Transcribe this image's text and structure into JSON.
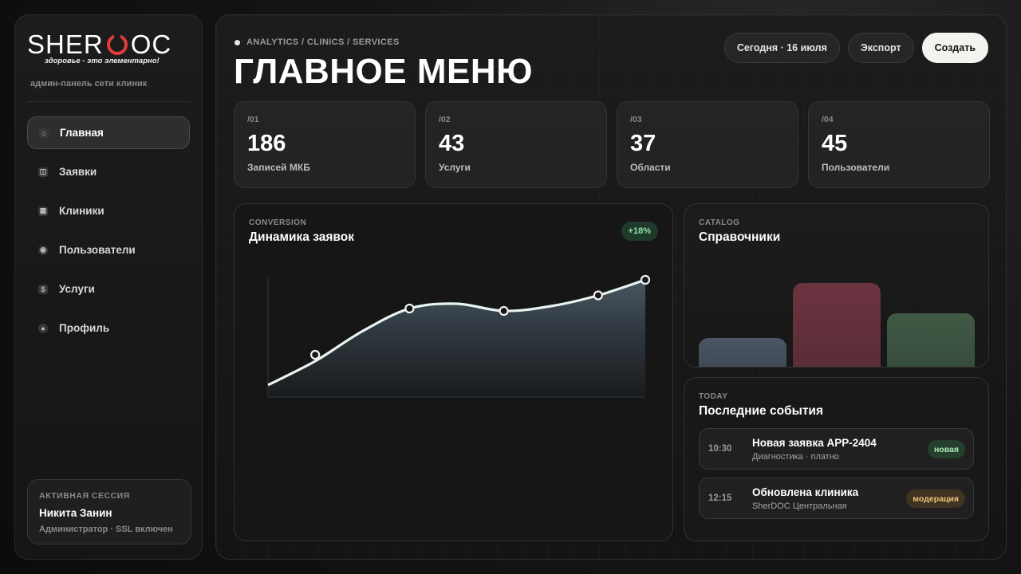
{
  "brand": {
    "logo_left": "SHER",
    "logo_right": "OC",
    "tagline": "здоровье - это элементарно!",
    "subtitle": "админ-панель сети клиник",
    "accent_color": "#e23b3b"
  },
  "sidebar": {
    "items": [
      {
        "label": "Главная",
        "icon": "home-icon",
        "active": true
      },
      {
        "label": "Заявки",
        "icon": "inbox-icon",
        "active": false
      },
      {
        "label": "Клиники",
        "icon": "building-icon",
        "active": false
      },
      {
        "label": "Пользователи",
        "icon": "user-icon",
        "active": false
      },
      {
        "label": "Услуги",
        "icon": "dollar-icon",
        "active": false
      },
      {
        "label": "Профиль",
        "icon": "profile-icon",
        "active": false
      }
    ],
    "session": {
      "label": "АКТИВНАЯ СЕССИЯ",
      "name": "Никита Занин",
      "role": "Администратор · SSL включен"
    }
  },
  "header": {
    "breadcrumb": "ANALYTICS / CLINICS / SERVICES",
    "title": "ГЛАВНОЕ МЕНЮ",
    "date_button": "Сегодня · 16 июля",
    "export_button": "Экспорт",
    "create_button": "Создать"
  },
  "stats": [
    {
      "index": "/01",
      "value": "186",
      "caption": "Записей МКБ"
    },
    {
      "index": "/02",
      "value": "43",
      "caption": "Услуги"
    },
    {
      "index": "/03",
      "value": "37",
      "caption": "Области"
    },
    {
      "index": "/04",
      "value": "45",
      "caption": "Пользователи"
    }
  ],
  "conversion": {
    "kicker": "CONVERSION",
    "title": "Динамика заявок",
    "badge": "+18%"
  },
  "catalog": {
    "kicker": "CATALOG",
    "title": "Справочники",
    "bar_colors": [
      "#4a5666",
      "#6b3340",
      "#3f5a45"
    ]
  },
  "events": {
    "kicker": "TODAY",
    "title": "Последние события",
    "items": [
      {
        "time": "10:30",
        "title": "Новая заявка APP-2404",
        "subtitle": "Диагностика · платно",
        "tag": "новая",
        "tag_style": "green"
      },
      {
        "time": "12:15",
        "title": "Обновлена клиника",
        "subtitle": "SherDOC Центральная",
        "tag": "модерация",
        "tag_style": "amber"
      }
    ]
  },
  "chart_data": [
    {
      "type": "area",
      "title": "Динамика заявок",
      "x": [
        0,
        1,
        2,
        3,
        4,
        5,
        6,
        7,
        8
      ],
      "values": [
        0.1,
        0.3,
        0.55,
        0.74,
        0.78,
        0.72,
        0.76,
        0.85,
        0.98
      ],
      "markers": [
        1,
        3,
        5,
        7,
        8
      ],
      "ylim": [
        0,
        1
      ],
      "grid": false,
      "legend": "none"
    },
    {
      "type": "bar",
      "title": "Справочники",
      "categories": [
        "",
        "",
        ""
      ],
      "values": [
        0.35,
        1.0,
        0.64
      ],
      "ylim": [
        0,
        1
      ],
      "grid": false
    }
  ]
}
